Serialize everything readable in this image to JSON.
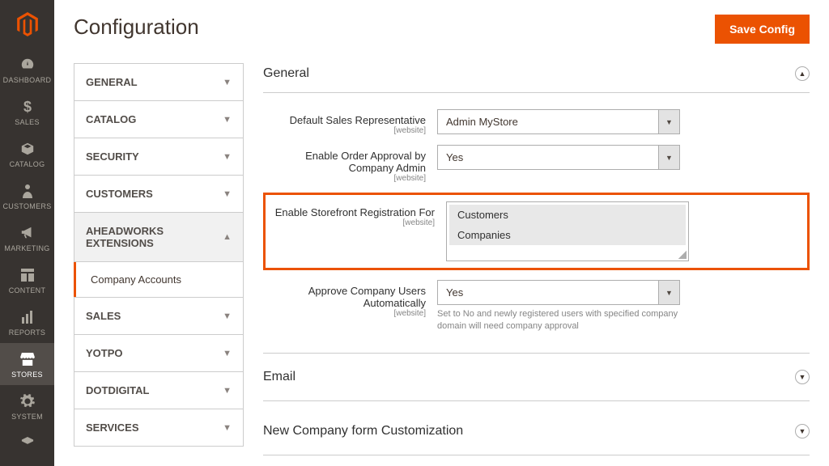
{
  "header": {
    "title": "Configuration",
    "save_label": "Save Config"
  },
  "rail": [
    {
      "label": "DASHBOARD"
    },
    {
      "label": "SALES"
    },
    {
      "label": "CATALOG"
    },
    {
      "label": "CUSTOMERS"
    },
    {
      "label": "MARKETING"
    },
    {
      "label": "CONTENT"
    },
    {
      "label": "REPORTS"
    },
    {
      "label": "STORES"
    },
    {
      "label": "SYSTEM"
    }
  ],
  "sidebar": {
    "items": [
      {
        "label": "GENERAL"
      },
      {
        "label": "CATALOG"
      },
      {
        "label": "SECURITY"
      },
      {
        "label": "CUSTOMERS"
      },
      {
        "label": "AHEADWORKS EXTENSIONS"
      },
      {
        "label": "SALES"
      },
      {
        "label": "YOTPO"
      },
      {
        "label": "DOTDIGITAL"
      },
      {
        "label": "SERVICES"
      }
    ],
    "sub_item": "Company Accounts"
  },
  "sections": {
    "general": {
      "title": "General",
      "default_rep_label": "Default Sales Representative",
      "default_rep_value": "Admin MyStore",
      "order_approval_label": "Enable Order Approval by Company Admin",
      "order_approval_value": "Yes",
      "storefront_reg_label": "Enable Storefront Registration For",
      "storefront_options": {
        "opt1": "Customers",
        "opt2": "Companies"
      },
      "auto_approve_label": "Approve Company Users Automatically",
      "auto_approve_value": "Yes",
      "auto_approve_help": "Set to No and newly registered users with specified company domain will need company approval",
      "scope": "[website]"
    },
    "email": {
      "title": "Email"
    },
    "custom": {
      "title": "New Company form Customization"
    }
  }
}
